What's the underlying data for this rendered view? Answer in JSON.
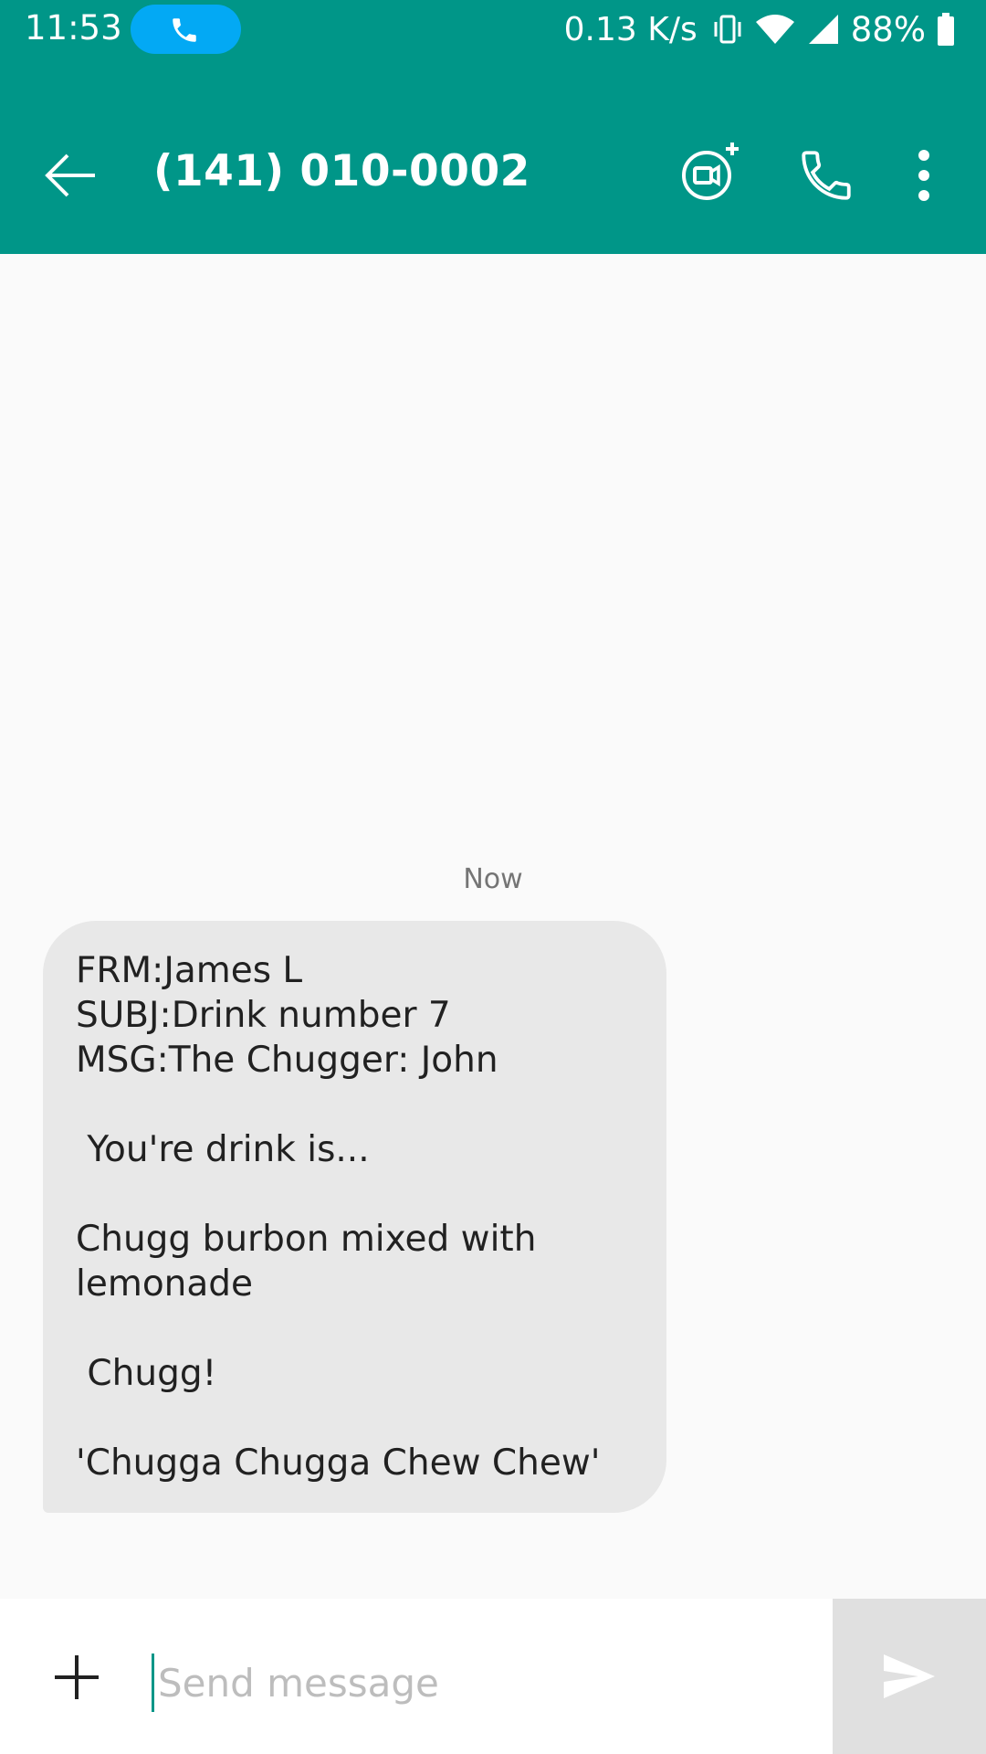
{
  "status_bar": {
    "time": "11:53",
    "net_speed": "0.13 K/s",
    "battery": "88%",
    "call_pill_color": "#03a9f4",
    "icons": [
      "phone-icon",
      "vibrate-icon",
      "wifi-icon",
      "signal-icon",
      "battery-icon"
    ]
  },
  "app_bar": {
    "title": "(141) 010-0002",
    "background": "#009688",
    "icons": [
      "back-arrow-icon",
      "video-call-add-icon",
      "phone-icon",
      "more-vert-icon"
    ]
  },
  "conversation": {
    "timestamp": "Now",
    "messages": [
      {
        "direction": "incoming",
        "text": "FRM:James L\nSUBJ:Drink number 7\nMSG:The Chugger: John\n\n You're drink is...\n\nChugg burbon mixed with lemonade\n\n Chugg!\n\n'Chugga Chugga Chew Chew'"
      }
    ]
  },
  "composer": {
    "placeholder": "Send message",
    "value": "",
    "icons": [
      "plus-icon",
      "send-icon"
    ]
  }
}
